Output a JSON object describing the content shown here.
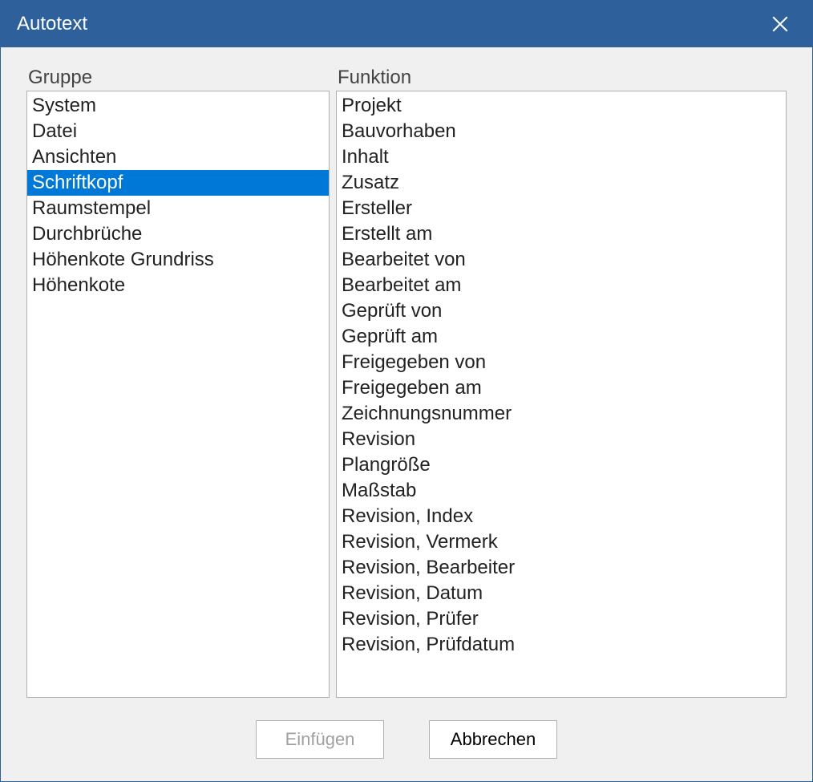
{
  "window": {
    "title": "Autotext"
  },
  "labels": {
    "group": "Gruppe",
    "function": "Funktion"
  },
  "groupList": {
    "selectedIndex": 3,
    "items": [
      "System",
      "Datei",
      "Ansichten",
      "Schriftkopf",
      "Raumstempel",
      "Durchbrüche",
      "Höhenkote Grundriss",
      "Höhenkote"
    ]
  },
  "functionList": {
    "selectedIndex": -1,
    "items": [
      "Projekt",
      "Bauvorhaben",
      "Inhalt",
      "Zusatz",
      "Ersteller",
      "Erstellt am",
      "Bearbeitet von",
      "Bearbeitet am",
      "Geprüft von",
      "Geprüft am",
      "Freigegeben von",
      "Freigegeben am",
      "Zeichnungsnummer",
      "Revision",
      "Plangröße",
      "Maßstab",
      "Revision, Index",
      "Revision, Vermerk",
      "Revision, Bearbeiter",
      "Revision, Datum",
      "Revision, Prüfer",
      "Revision, Prüfdatum"
    ]
  },
  "buttons": {
    "insert": "Einfügen",
    "cancel": "Abbrechen",
    "insertEnabled": false
  },
  "colors": {
    "titlebar": "#2e619c",
    "selection": "#0078d7"
  }
}
